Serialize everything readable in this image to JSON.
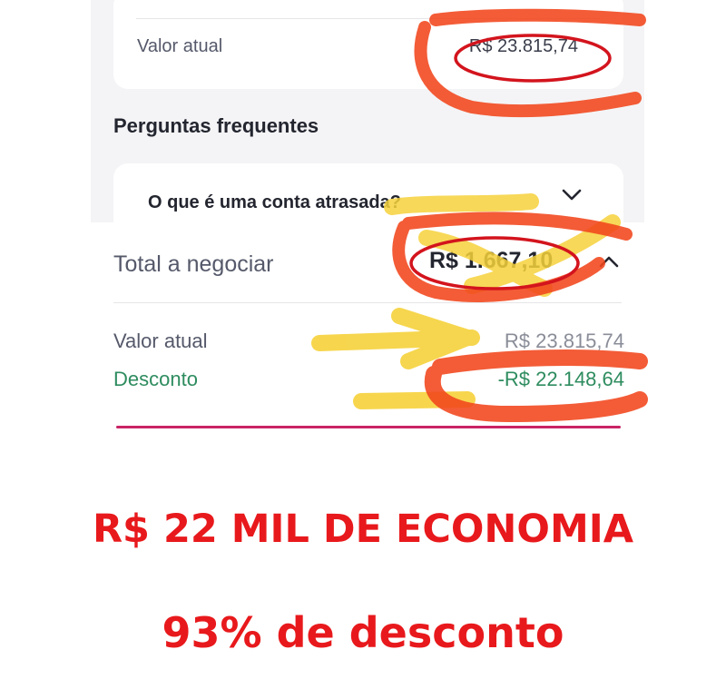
{
  "top": {
    "value_label": "Valor atual",
    "value_amount": "R$ 23.815,74",
    "faq_title": "Perguntas frequentes",
    "faq_question": "O que é uma conta atrasada?"
  },
  "negotiation": {
    "total_label": "Total a negociar",
    "total_amount": "R$ 1.667,10",
    "current_label": "Valor atual",
    "current_amount": "R$ 23.815,74",
    "discount_label": "Desconto",
    "discount_amount": "-R$ 22.148,64"
  },
  "captions": {
    "headline": "R$ 22 MIL DE ECONOMIA",
    "subline": "93% de desconto"
  },
  "icons": {
    "faq_toggle": "chevron-down-icon",
    "total_toggle": "chevron-up-icon"
  },
  "colors": {
    "headline_red": "#e8191c",
    "discount_green": "#2e8c5f",
    "marker_orange": "#f2461c",
    "marker_yellow": "#f6d23b",
    "accent_pink": "#c92365"
  }
}
